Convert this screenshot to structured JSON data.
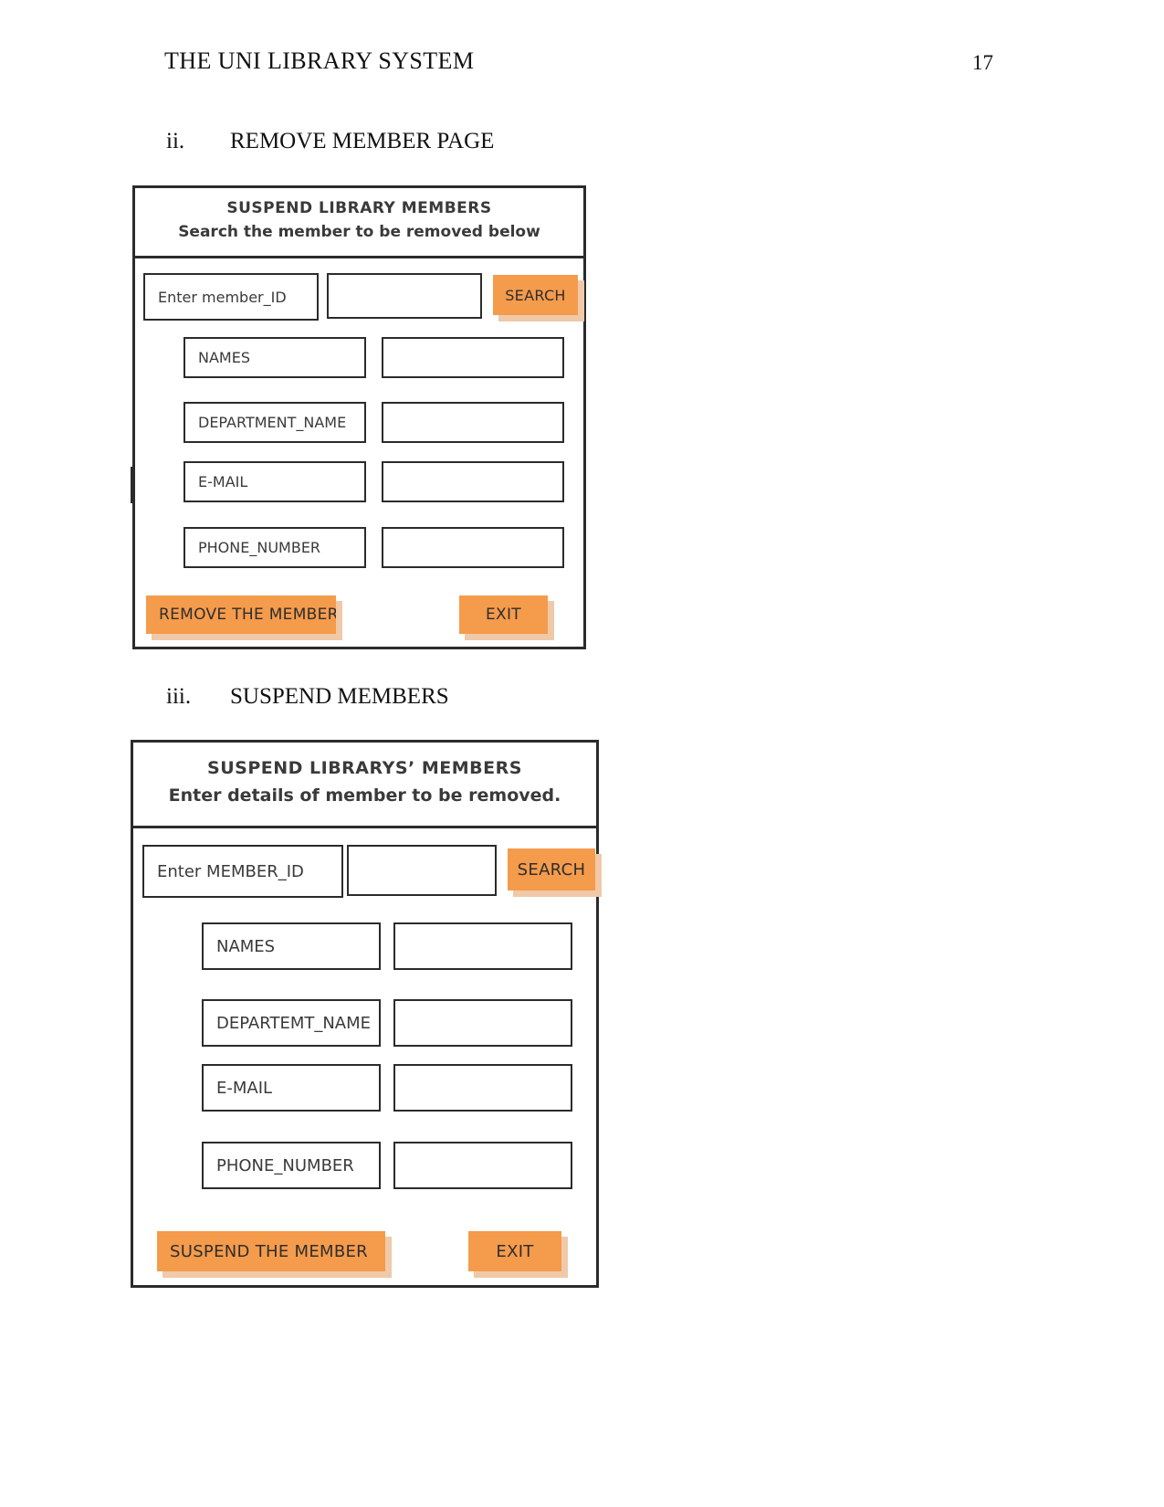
{
  "page": {
    "running_head": "THE UNI LIBRARY SYSTEM",
    "page_number": "17"
  },
  "sections": [
    {
      "numeral": "ii.",
      "heading": "REMOVE MEMBER PAGE"
    },
    {
      "numeral": "iii.",
      "heading": "SUSPEND MEMBERS"
    }
  ],
  "mockup_remove": {
    "title": "SUSPEND LIBRARY MEMBERS",
    "subtitle": "Search the member to be removed below",
    "search": {
      "label": "Enter member_ID",
      "value": "",
      "button_label": "SEARCH"
    },
    "fields": [
      {
        "label": "NAMES",
        "value": ""
      },
      {
        "label": "DEPARTMENT_NAME",
        "value": ""
      },
      {
        "label": "E-MAIL",
        "value": ""
      },
      {
        "label": "PHONE_NUMBER",
        "value": ""
      }
    ],
    "actions": {
      "primary_label": "REMOVE THE MEMBER",
      "exit_label": "EXIT"
    }
  },
  "mockup_suspend": {
    "title": "SUSPEND LIBRARYS’ MEMBERS",
    "subtitle": "Enter details of member to be removed.",
    "search": {
      "label": "Enter MEMBER_ID",
      "value": "",
      "button_label": "SEARCH"
    },
    "fields": [
      {
        "label": "NAMES",
        "value": ""
      },
      {
        "label": "DEPARTEMT_NAME",
        "value": ""
      },
      {
        "label": "E-MAIL",
        "value": ""
      },
      {
        "label": "PHONE_NUMBER",
        "value": ""
      }
    ],
    "actions": {
      "primary_label": "SUSPEND THE MEMBER",
      "exit_label": "EXIT"
    }
  },
  "colors": {
    "button_orange": "#f59b4c",
    "button_shadow": "#f0c9a8",
    "border_dark": "#2b2b2b",
    "text_gray": "#3a3a3a"
  }
}
